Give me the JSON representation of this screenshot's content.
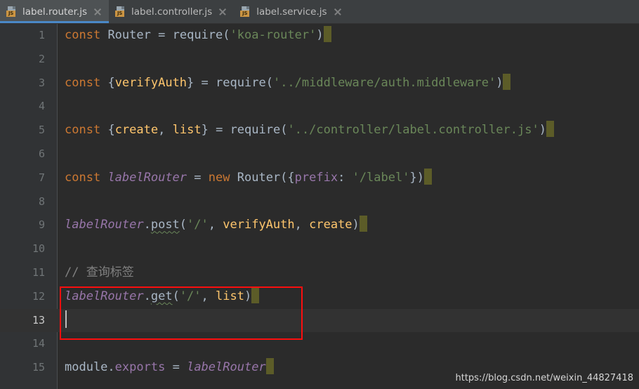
{
  "tabs": [
    {
      "label": "label.router.js",
      "icon": "js-file-icon",
      "badge": "JS",
      "active": true,
      "close_icon": "close-icon"
    },
    {
      "label": "label.controller.js",
      "icon": "js-file-icon",
      "badge": "JS",
      "active": false,
      "close_icon": "close-icon"
    },
    {
      "label": "label.service.js",
      "icon": "js-file-icon",
      "badge": "JS",
      "active": false,
      "close_icon": "close-icon"
    }
  ],
  "editor": {
    "active_line": 13,
    "line_numbers": [
      "1",
      "2",
      "3",
      "4",
      "5",
      "6",
      "7",
      "8",
      "9",
      "10",
      "11",
      "12",
      "13",
      "14",
      "15"
    ],
    "lines": [
      {
        "n": "1",
        "text": "const Router = require('koa-router')"
      },
      {
        "n": "2",
        "text": ""
      },
      {
        "n": "3",
        "text": "const {verifyAuth} = require('../middleware/auth.middleware')"
      },
      {
        "n": "4",
        "text": ""
      },
      {
        "n": "5",
        "text": "const {create, list} = require('../controller/label.controller.js')"
      },
      {
        "n": "6",
        "text": ""
      },
      {
        "n": "7",
        "text": "const labelRouter = new Router({prefix: '/label'})"
      },
      {
        "n": "8",
        "text": ""
      },
      {
        "n": "9",
        "text": "labelRouter.post('/', verifyAuth, create)"
      },
      {
        "n": "10",
        "text": ""
      },
      {
        "n": "11",
        "text": "// 查询标签"
      },
      {
        "n": "12",
        "text": "labelRouter.get('/', list)"
      },
      {
        "n": "13",
        "text": ""
      },
      {
        "n": "14",
        "text": ""
      },
      {
        "n": "15",
        "text": "module.exports = labelRouter"
      }
    ],
    "tokens": {
      "const": "const",
      "new": "new",
      "Router": "Router",
      "require": "require",
      "koa_router_str": "'koa-router'",
      "verifyAuth": "verifyAuth",
      "auth_middleware_str": "'../middleware/auth.middleware'",
      "create": "create",
      "list": "list",
      "label_controller_str": "'../controller/label.controller.js'",
      "labelRouter": "labelRouter",
      "prefix": "prefix",
      "label_str": "'/label'",
      "post": "post",
      "get": "get",
      "slash_str": "'/'",
      "comment_query_label": "// 查询标签",
      "module": "module",
      "exports": "exports"
    }
  },
  "annotation": {
    "box_color": "#fb0e0e",
    "highlights_lines": [
      "11",
      "12"
    ]
  },
  "watermark": {
    "text": "https://blog.csdn.net/weixin_44827418"
  },
  "theme": {
    "background": "#2b2b2b",
    "gutter_background": "#313335",
    "active_line_background": "#323232",
    "tabbar_background": "#3c3f41",
    "active_tab_background": "#4e5254",
    "active_tab_underline": "#4a88c7",
    "keyword": "#cc7832",
    "string": "#6a8759",
    "identifier": "#a9b7c6",
    "parameter": "#ffc66d",
    "field": "#9876aa",
    "comment": "#808080",
    "inspection_block": "#5c5c28",
    "js_badge": "#cc9543"
  }
}
